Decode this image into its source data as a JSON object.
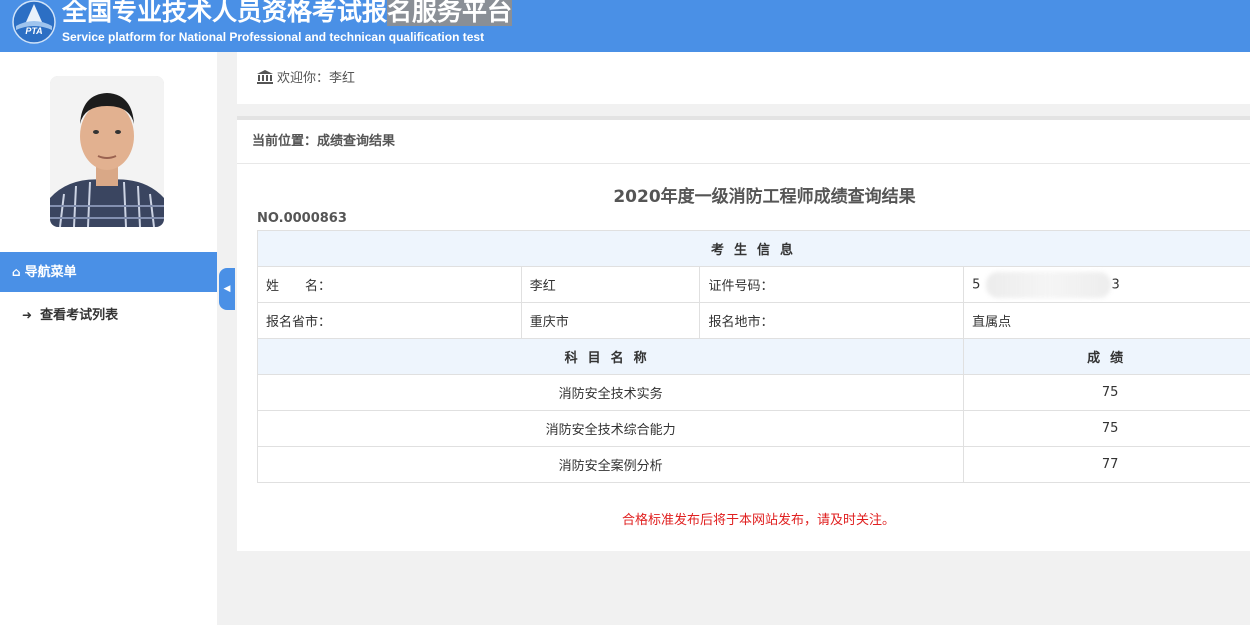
{
  "header": {
    "title_a": "全国专业技术人员资格考试报",
    "title_b": "名服务平台",
    "subtitle": "Service platform for National Professional and technican qualification test",
    "logo_text": "PTA"
  },
  "sidebar": {
    "nav_title": "导航菜单",
    "items": [
      {
        "label": "查看考试列表"
      }
    ]
  },
  "welcome": {
    "text": "欢迎你：李红"
  },
  "breadcrumb": {
    "text": "当前位置：成绩查询结果"
  },
  "result": {
    "title": "2020年度一级消防工程师成绩查询结果",
    "number": "NO.0000863",
    "section_info": "考生信息",
    "name_label": "姓　　名：",
    "name_value": "李红",
    "id_label": "证件号码：",
    "id_value_start": "5",
    "id_value_end": "3",
    "province_label": "报名省市：",
    "province_value": "重庆市",
    "city_label": "报名地市：",
    "city_value": "直属点",
    "subject_header": "科目名称",
    "score_header": "成绩",
    "subjects": [
      {
        "name": "消防安全技术实务",
        "score": "75"
      },
      {
        "name": "消防安全技术综合能力",
        "score": "75"
      },
      {
        "name": "消防安全案例分析",
        "score": "77"
      }
    ],
    "note": "合格标准发布后将于本网站发布，请及时关注。"
  },
  "colors": {
    "brand": "#4a90e6",
    "note": "#e02020",
    "section_bg": "#eef5fd"
  }
}
